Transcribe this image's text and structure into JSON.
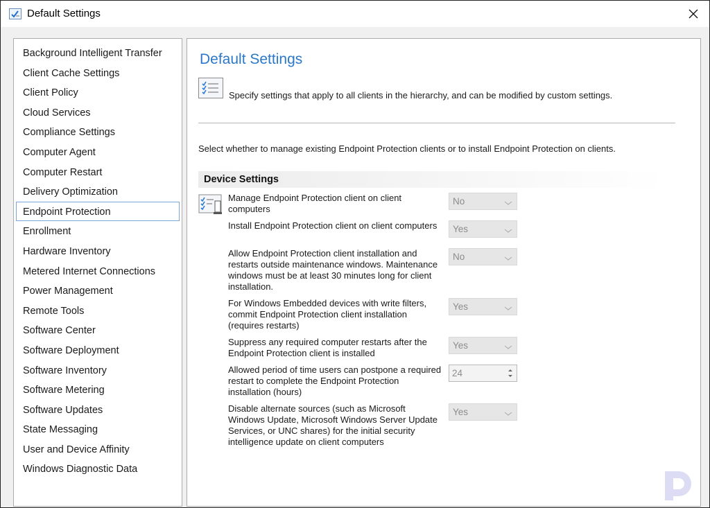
{
  "window": {
    "title": "Default Settings",
    "icon": "settings-checklist-icon",
    "close_icon": "close-icon"
  },
  "sidebar": {
    "items": [
      {
        "label": "Background Intelligent Transfer",
        "selected": false
      },
      {
        "label": "Client Cache Settings",
        "selected": false
      },
      {
        "label": "Client Policy",
        "selected": false
      },
      {
        "label": "Cloud Services",
        "selected": false
      },
      {
        "label": "Compliance Settings",
        "selected": false
      },
      {
        "label": "Computer Agent",
        "selected": false
      },
      {
        "label": "Computer Restart",
        "selected": false
      },
      {
        "label": "Delivery Optimization",
        "selected": false
      },
      {
        "label": "Endpoint Protection",
        "selected": true
      },
      {
        "label": "Enrollment",
        "selected": false
      },
      {
        "label": "Hardware Inventory",
        "selected": false
      },
      {
        "label": "Metered Internet Connections",
        "selected": false
      },
      {
        "label": "Power Management",
        "selected": false
      },
      {
        "label": "Remote Tools",
        "selected": false
      },
      {
        "label": "Software Center",
        "selected": false
      },
      {
        "label": "Software Deployment",
        "selected": false
      },
      {
        "label": "Software Inventory",
        "selected": false
      },
      {
        "label": "Software Metering",
        "selected": false
      },
      {
        "label": "Software Updates",
        "selected": false
      },
      {
        "label": "State Messaging",
        "selected": false
      },
      {
        "label": "User and Device Affinity",
        "selected": false
      },
      {
        "label": "Windows Diagnostic Data",
        "selected": false
      }
    ]
  },
  "content": {
    "title": "Default Settings",
    "description": "Specify settings that apply to all clients in the hierarchy, and can be modified by custom settings.",
    "intro": "Select whether to manage existing Endpoint Protection clients or to install Endpoint Protection on clients.",
    "section_title": "Device Settings",
    "settings": [
      {
        "label": "Manage Endpoint Protection client on client computers",
        "control": "dropdown",
        "value": "No"
      },
      {
        "label": "Install Endpoint Protection client on client computers",
        "control": "dropdown",
        "value": "Yes"
      },
      {
        "label": "Allow Endpoint Protection client installation and restarts outside maintenance windows. Maintenance windows must be at least 30 minutes long for client installation.",
        "control": "dropdown",
        "value": "No"
      },
      {
        "label": "For Windows Embedded devices with write filters, commit Endpoint Protection client installation (requires restarts)",
        "control": "dropdown",
        "value": "Yes"
      },
      {
        "label": "Suppress any required computer restarts after the Endpoint Protection client is installed",
        "control": "dropdown",
        "value": "Yes"
      },
      {
        "label": "Allowed period of time users can postpone a required restart to complete the Endpoint Protection installation (hours)",
        "control": "spinner",
        "value": "24"
      },
      {
        "label": "Disable alternate sources (such as Microsoft Windows Update, Microsoft Windows Server Update Services, or UNC shares) for the initial security intelligence update on client computers",
        "control": "dropdown",
        "value": "Yes"
      }
    ]
  },
  "colors": {
    "title_accent": "#2b78c9",
    "selection_border": "#7aa7d9",
    "disabled_text": "#8c8c8c"
  }
}
